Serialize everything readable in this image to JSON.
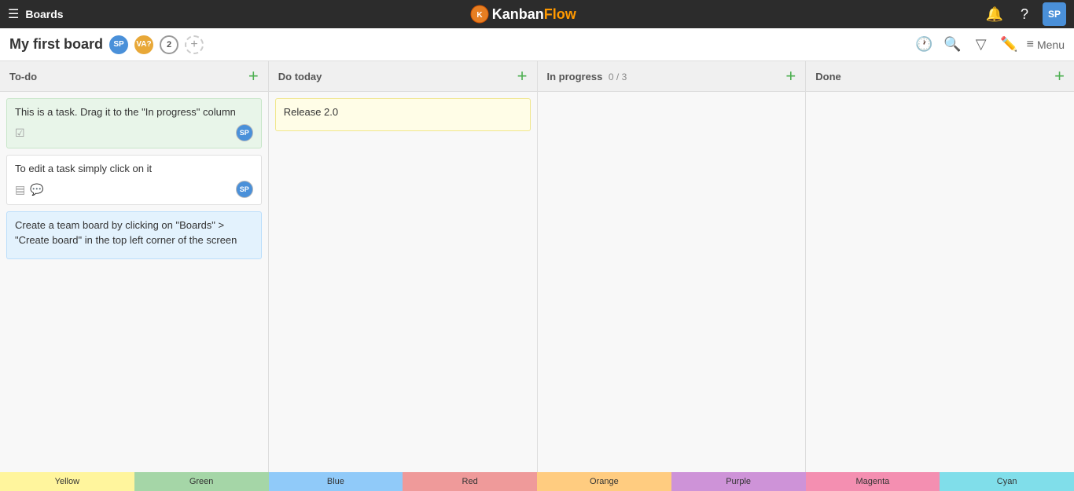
{
  "topNav": {
    "boardsLabel": "Boards",
    "logoKanban": "Kanban",
    "logoFlow": "Flow",
    "notificationIcon": "🔔",
    "helpIcon": "?",
    "userInitials": "SP"
  },
  "boardHeader": {
    "title": "My first board",
    "member1Initials": "SP",
    "member2Initials": "VA?",
    "memberCount": "2",
    "addMemberLabel": "+",
    "menuLabel": "Menu"
  },
  "columns": [
    {
      "id": "todo",
      "title": "To-do",
      "count": "",
      "cards": [
        {
          "id": "card1",
          "text": "This is a task. Drag it to the \"In progress\" column",
          "color": "green",
          "hasChecklist": true,
          "avatar": "SP"
        },
        {
          "id": "card2",
          "text": "To edit a task simply click on it",
          "color": "white",
          "hasNote": true,
          "hasComment": true,
          "avatar": "SP"
        },
        {
          "id": "card3",
          "text": "Create a team board by clicking on \"Boards\" > \"Create board\" in the top left corner of the screen",
          "color": "blue",
          "hasNote": false,
          "hasComment": false,
          "avatar": ""
        }
      ]
    },
    {
      "id": "do-today",
      "title": "Do today",
      "count": "",
      "cards": [
        {
          "id": "card4",
          "text": "Release 2.0",
          "color": "yellow",
          "hasNote": false,
          "hasComment": false,
          "avatar": ""
        }
      ]
    },
    {
      "id": "in-progress",
      "title": "In progress",
      "count": "0 / 3",
      "cards": []
    },
    {
      "id": "done",
      "title": "Done",
      "count": "",
      "cards": []
    }
  ],
  "colorBar": [
    {
      "label": "Yellow",
      "color": "#fff59d"
    },
    {
      "label": "Green",
      "color": "#a5d6a7"
    },
    {
      "label": "Blue",
      "color": "#90caf9"
    },
    {
      "label": "Red",
      "color": "#ef9a9a"
    },
    {
      "label": "Orange",
      "color": "#ffcc80"
    },
    {
      "label": "Purple",
      "color": "#ce93d8"
    },
    {
      "label": "Magenta",
      "color": "#f48fb1"
    },
    {
      "label": "Cyan",
      "color": "#80deea"
    }
  ]
}
